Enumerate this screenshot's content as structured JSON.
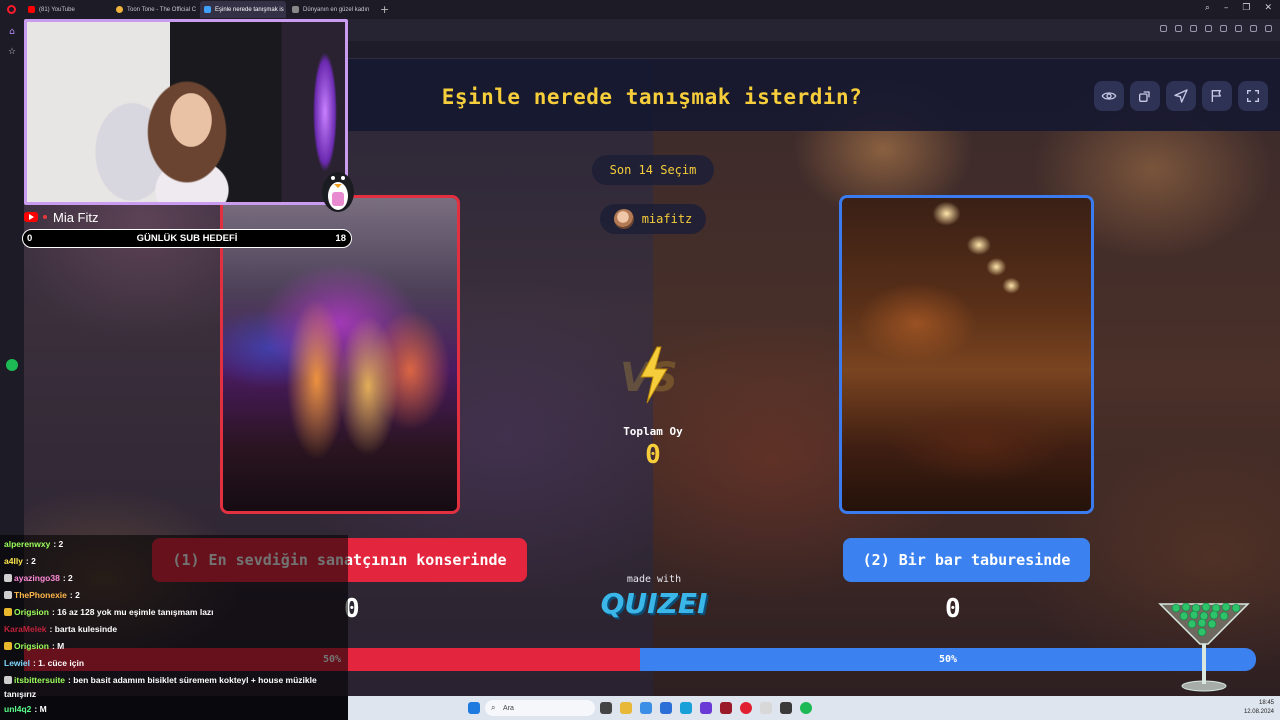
{
  "browser": {
    "tabs": [
      {
        "label": "(81) YouTube",
        "color": "#ff0000"
      },
      {
        "label": "Toon Tone - The Official C",
        "color": "#f0b43c"
      },
      {
        "label": "Eşinle nerede tanışmak is",
        "color": "#40a0ff"
      },
      {
        "label": "Dünyanın en güzel kadın",
        "color": "#888888"
      }
    ]
  },
  "quiz": {
    "question": "Eşinle nerede tanışmak isterdin?",
    "history_pill": "Son 14 Seçim",
    "host": "miafitz",
    "total_label": "Toplam Oy",
    "total_votes": "0",
    "left": {
      "label": "(1) En sevdiğin sanatçının konserinde",
      "votes": "0",
      "percent_label": "50%",
      "share": 0.5,
      "color": "#e3263d"
    },
    "right": {
      "label": "(2) Bir bar taburesinde",
      "votes": "0",
      "percent_label": "50%",
      "share": 0.5,
      "color": "#3b82f0"
    },
    "made_with": "made with",
    "brand": "QUIZEI"
  },
  "stream": {
    "streamer_name": "Mia Fitz",
    "sub_goal": {
      "current": "0",
      "title": "GÜNLÜK SUB HEDEFİ",
      "target": "18"
    }
  },
  "chat": [
    {
      "user": "alperenwxy",
      "color": "#9cff5a",
      "text": ": 2",
      "icon": ""
    },
    {
      "user": "a4lly",
      "color": "#ffe84a",
      "text": ": 2",
      "icon": ""
    },
    {
      "user": "ayazingo38",
      "color": "#ff8ad8",
      "text": ": 2",
      "icon": "gray"
    },
    {
      "user": "ThePhonexie",
      "color": "#ffb84a",
      "text": ": 2",
      "icon": "gray"
    },
    {
      "user": "Origsion",
      "color": "#9cff5a",
      "text": ": 16 az 128 yok mu eşimle tanışmam lazı",
      "icon": "gold"
    },
    {
      "user": "KaraMelek",
      "color": "#c0223a",
      "text": ": barta kulesinde",
      "icon": ""
    },
    {
      "user": "Origsion",
      "color": "#9cff5a",
      "text": ": M",
      "icon": "gold"
    },
    {
      "user": "Lewiel",
      "color": "#7fd9ff",
      "text": ": 1. cüce için",
      "icon": ""
    },
    {
      "user": "itsbittersuite",
      "color": "#9cff5a",
      "text": ": ben basit adamım bisiklet süremem kokteyl + house müzikle",
      "icon": "gray"
    },
    {
      "user": "",
      "color": "#ffffff",
      "text": "tanışırız",
      "icon": ""
    },
    {
      "user": "unl4q2",
      "color": "#5aff8a",
      "text": ": M",
      "icon": ""
    }
  ],
  "taskbar": {
    "search_placeholder": "Ara",
    "time": "18:45",
    "date": "12.08.2024"
  }
}
